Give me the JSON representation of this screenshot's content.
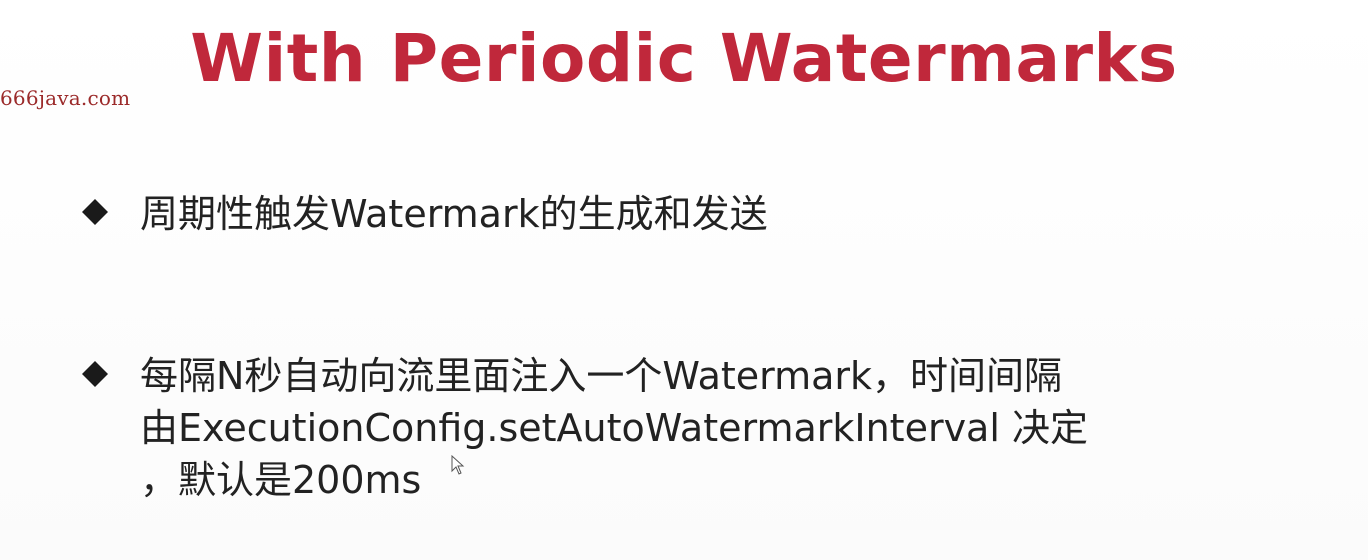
{
  "watermark": {
    "text": "666java.com"
  },
  "slide": {
    "title": "With Periodic Watermarks",
    "bullets": [
      {
        "lines": [
          "周期性触发Watermark的生成和发送"
        ]
      },
      {
        "lines": [
          "每隔N秒自动向流里面注入一个Watermark，时间间隔",
          "由ExecutionConfig.setAutoWatermarkInterval 决定",
          "，默认是200ms"
        ]
      }
    ]
  },
  "icons": {
    "bullet_marker": "diamond-bullet-icon",
    "pointer": "mouse-cursor-icon"
  },
  "colors": {
    "title": "#c0283b",
    "watermark": "#9b2a2a",
    "text": "#222222"
  }
}
